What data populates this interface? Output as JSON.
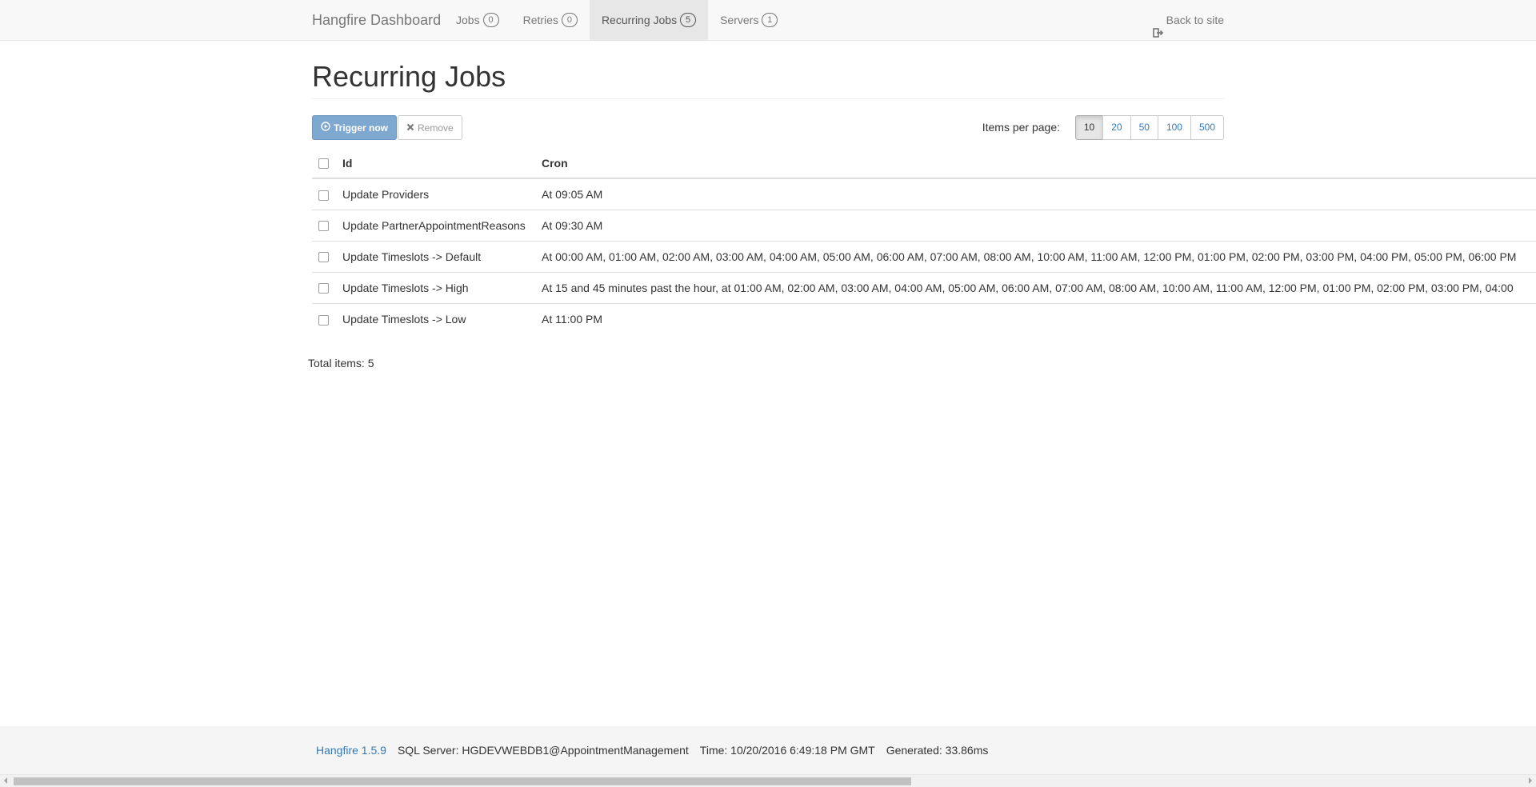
{
  "navbar": {
    "brand": "Hangfire Dashboard",
    "items": [
      {
        "label": "Jobs",
        "count": "0",
        "active": false
      },
      {
        "label": "Retries",
        "count": "0",
        "active": false
      },
      {
        "label": "Recurring Jobs",
        "count": "5",
        "active": true
      },
      {
        "label": "Servers",
        "count": "1",
        "active": false
      }
    ],
    "back_label": "Back to site"
  },
  "page": {
    "title": "Recurring Jobs"
  },
  "toolbar": {
    "trigger_label": "Trigger now",
    "remove_label": "Remove",
    "per_page_label": "Items per page:",
    "per_page_options": [
      "10",
      "20",
      "50",
      "100",
      "500"
    ],
    "per_page_selected": "10"
  },
  "table": {
    "headers": {
      "id": "Id",
      "cron": "Cron"
    },
    "rows": [
      {
        "id": "Update Providers",
        "cron": "At 09:05 AM"
      },
      {
        "id": "Update PartnerAppointmentReasons",
        "cron": "At 09:30 AM"
      },
      {
        "id": "Update Timeslots -> Default",
        "cron": "At 00:00 AM, 01:00 AM, 02:00 AM, 03:00 AM, 04:00 AM, 05:00 AM, 06:00 AM, 07:00 AM, 08:00 AM, 10:00 AM, 11:00 AM, 12:00 PM, 01:00 PM, 02:00 PM, 03:00 PM, 04:00 PM, 05:00 PM, 06:00 PM"
      },
      {
        "id": "Update Timeslots -> High",
        "cron": "At 15 and 45 minutes past the hour, at 01:00 AM, 02:00 AM, 03:00 AM, 04:00 AM, 05:00 AM, 06:00 AM, 07:00 AM, 08:00 AM, 10:00 AM, 11:00 AM, 12:00 PM, 01:00 PM, 02:00 PM, 03:00 PM, 04:00"
      },
      {
        "id": "Update Timeslots -> Low",
        "cron": "At 11:00 PM"
      }
    ]
  },
  "summary": {
    "total_items": "Total items: 5"
  },
  "footer": {
    "version": "Hangfire 1.5.9",
    "server": "SQL Server: HGDEVWEBDB1@AppointmentManagement",
    "time": "Time: 10/20/2016 6:49:18 PM GMT",
    "generated": "Generated: 33.86ms"
  },
  "colors": {
    "primary": "#7ea8d0",
    "link": "#337ab7",
    "navbar_bg": "#f8f8f8"
  }
}
